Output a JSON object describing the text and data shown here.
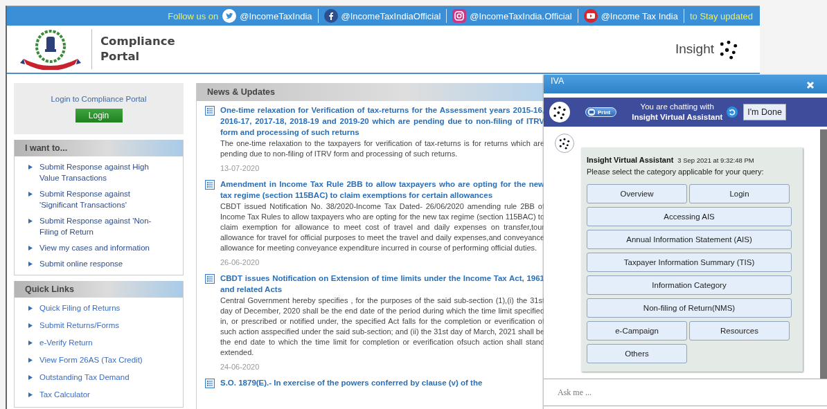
{
  "banner": {
    "follow_label": "Follow us on",
    "links": [
      {
        "kind": "twitter",
        "handle": "@IncomeTaxIndia"
      },
      {
        "kind": "facebook",
        "handle": "@IncomeTaxIndiaOfficial"
      },
      {
        "kind": "instagram",
        "handle": "@IncomeTaxIndia.Official"
      },
      {
        "kind": "youtube",
        "handle": "@Income Tax India"
      }
    ],
    "tail": "to Stay updated"
  },
  "header": {
    "title": "Compliance Portal",
    "brand": "Insight"
  },
  "login_box": {
    "prompt": "Login to Compliance Portal",
    "button": "Login"
  },
  "i_want_to": {
    "heading": "I want to...",
    "items": [
      "Submit Response against High Value Transactions",
      "Submit Response against 'Significant Transactions'",
      "Submit Response against 'Non-Filing of Return",
      "View my cases and information",
      "Submit online response"
    ]
  },
  "quick_links": {
    "heading": "Quick Links",
    "items": [
      "Quick Filing of Returns",
      "Submit Returns/Forms",
      "e-Verify Return",
      "View Form 26AS (Tax Credit)",
      "Outstanding Tax Demand",
      "Tax Calculator"
    ]
  },
  "news": {
    "heading": "News & Updates",
    "items": [
      {
        "title": "One-time relaxation for Verification of tax-returns for the Assessment years 2015-16, 2016-17, 2017-18, 2018-19 and 2019-20 which are pending due to non-filing of ITRV form and processing of such returns",
        "summary": "The one-time relaxation to the taxpayers for verification of tax-returns is for returns which are pending due to non-filing of ITRV form and processing of such returns.",
        "date": "13-07-2020"
      },
      {
        "title": "Amendment in Income Tax Rule 2BB to allow taxpayers who are opting for the new tax regime (section 115BAC) to claim exemptions for certain allowances",
        "summary": "CBDT issued Notification No. 38/2020-Income Tax Dated- 26/06/2020 amending rule 2BB of Income Tax Rules to allow taxpayers who are opting for the new tax regime (section 115BAC) to claim exemption for allowance to meet cost of travel and daily expenses on transfer,tour allowance for travel for official purposes to meet the travel and daily expenses,and conveyance allowance for meeting conveyance expenditure incurred in course of performing official duties.",
        "date": "26-06-2020"
      },
      {
        "title": "CBDT issues Notification on Extension of time limits under the Income Tax Act, 1961 and related Acts",
        "summary": "Central Government hereby specifies , for the purposes of the said sub-section (1),(i) the 31st day of December, 2020 shall be the end date of the period during which the time limit specified in, or prescribed or notified under, the specified Act falls for the completion or everification of such action asspecified under the said sub-section; and (ii) the 31st day of March, 2021 shall be the end date to which the time limit for completion or everification ofsuch action shall stand extended.",
        "date": "24-06-2020"
      },
      {
        "title": "S.O. 1879(E).- In exercise of the powers conferred by clause (v) of the"
      }
    ]
  },
  "chat": {
    "title": "IVA",
    "print_label": "Print",
    "status_line": "You are chatting with",
    "assistant_name": "Insight Virtual Assistant",
    "done_button": "I'm Done",
    "message": {
      "sender": "Insight Virtual Assistant",
      "time": "3 Sep 2021 at 9:32:48 PM",
      "text": "Please select the category applicable for your query:",
      "options": [
        {
          "label": "Overview",
          "kind": "half"
        },
        {
          "label": "Login",
          "kind": "half"
        },
        {
          "label": "Accessing AIS",
          "kind": "full"
        },
        {
          "label": "Annual Information Statement (AIS)",
          "kind": "full"
        },
        {
          "label": "Taxpayer Information Summary (TIS)",
          "kind": "full"
        },
        {
          "label": "Information Category",
          "kind": "full"
        },
        {
          "label": "Non-filing of Return(NMS)",
          "kind": "full"
        },
        {
          "label": "e-Campaign",
          "kind": "half"
        },
        {
          "label": "Resources",
          "kind": "half"
        },
        {
          "label": "Others",
          "kind": "half"
        }
      ]
    },
    "input": {
      "placeholder": "Ask me ..."
    }
  }
}
